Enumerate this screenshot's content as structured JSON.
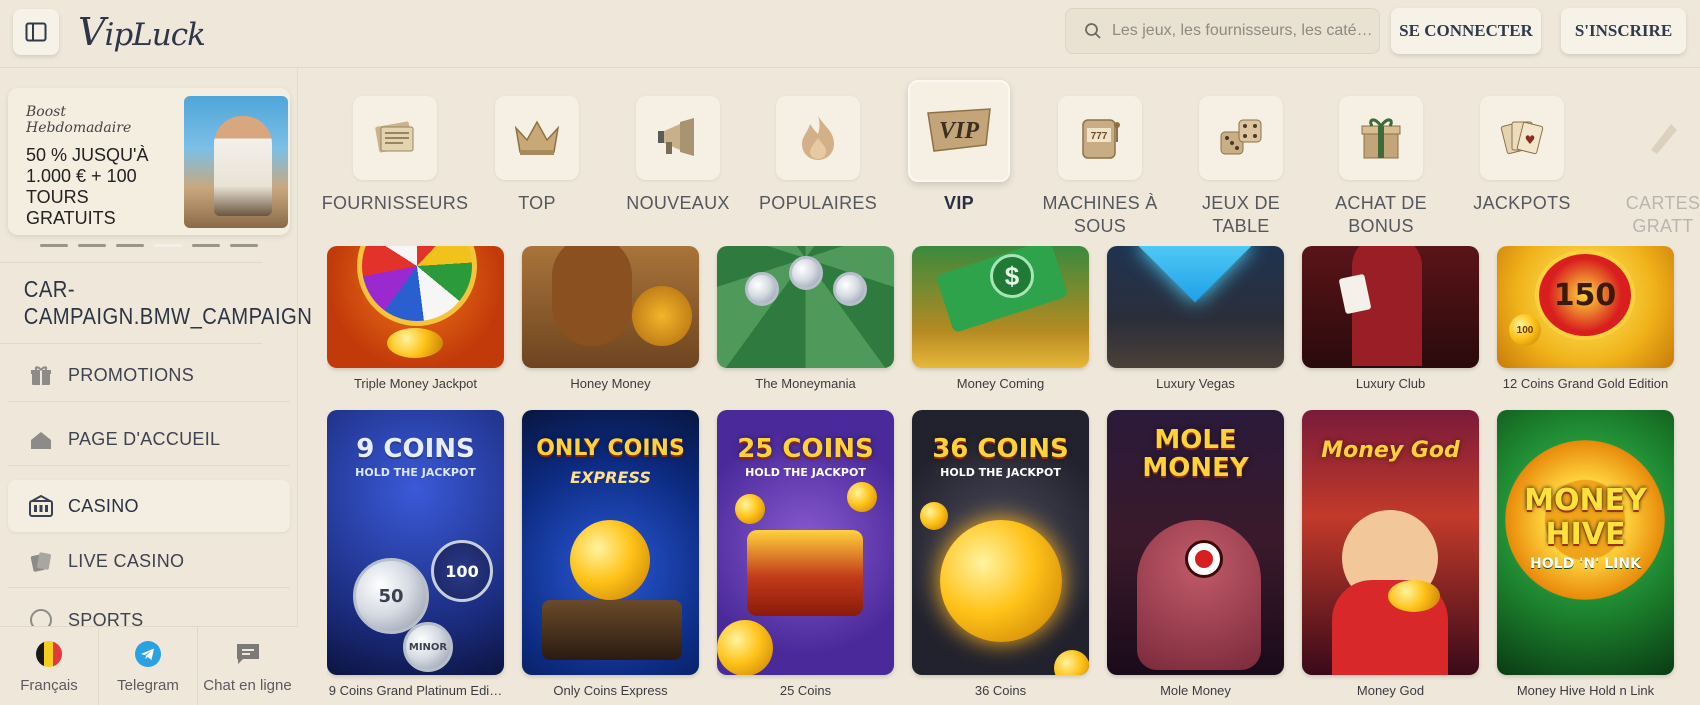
{
  "header": {
    "logo": {
      "initial": "V",
      "rest1": "ip",
      "rest2": "Luck"
    },
    "search_placeholder": "Les jeux, les fournisseurs, les caté…",
    "login_label": "SE CONNECTER",
    "signup_label": "S'INSCRIRE"
  },
  "sidebar": {
    "promo": {
      "tag_line1": "Boost",
      "tag_line2": "Hebdomadaire",
      "title": "50 % JUSQU'À 1.000 € + 100 TOURS GRATUITS"
    },
    "campaign": "CAR-CAMPAIGN.BMW_CAMPAIGN",
    "nav": [
      {
        "label": "PROMOTIONS",
        "icon": "gift-icon"
      },
      {
        "label": "PAGE D'ACCUEIL",
        "icon": "home-icon"
      },
      {
        "label": "CASINO",
        "icon": "casino-icon",
        "active": true
      },
      {
        "label": "LIVE CASINO",
        "icon": "cards-icon"
      },
      {
        "label": "SPORTS",
        "icon": "sports-icon"
      }
    ],
    "bottom": [
      {
        "label": "Français",
        "icon": "belgium-flag-icon"
      },
      {
        "label": "Telegram",
        "icon": "telegram-icon"
      },
      {
        "label": "Chat en ligne",
        "icon": "chat-icon"
      }
    ]
  },
  "categories": [
    {
      "label": "FOURNISSEURS",
      "icon": "newspaper-icon"
    },
    {
      "label": "TOP",
      "icon": "crown-icon"
    },
    {
      "label": "NOUVEAUX",
      "icon": "megaphone-icon"
    },
    {
      "label": "POPULAIRES",
      "icon": "flame-icon"
    },
    {
      "label": "VIP",
      "icon": "vip-icon",
      "active": true
    },
    {
      "label": "MACHINES À SOUS",
      "icon": "slot-machine-icon"
    },
    {
      "label": "JEUX DE TABLE",
      "icon": "dice-icon"
    },
    {
      "label": "ACHAT DE BONUS",
      "icon": "gift-box-icon"
    },
    {
      "label": "JACKPOTS",
      "icon": "playing-cards-icon"
    },
    {
      "label": "CARTES GRATT",
      "icon": "scratch-card-icon"
    }
  ],
  "games_row1": [
    "Triple Money Jackpot",
    "Honey Money",
    "The Moneymania",
    "Money Coming",
    "Luxury Vegas",
    "Luxury Club",
    "12 Coins Grand Gold Edition"
  ],
  "games_row2": [
    "9 Coins Grand Platinum Edi…",
    "Only Coins Express",
    "25 Coins",
    "36 Coins",
    "Mole Money",
    "Money God",
    "Money Hive Hold n Link"
  ],
  "thumb_art": {
    "money_coming_symbol": "$",
    "coins12_value": "150",
    "coins12_small": "100",
    "coins9_title": "9 COINS",
    "coins9_sub": "HOLD THE JACKPOT",
    "coins9_values": [
      "100",
      "50",
      "MINOR"
    ],
    "only_coins_title": "ONLY COINS",
    "only_coins_sub": "EXPRESS",
    "coins25_title": "25 COINS",
    "coins25_sub": "HOLD THE JACKPOT",
    "coins36_title": "36 COINS",
    "coins36_sub": "HOLD THE JACKPOT",
    "mole_title1": "MOLE",
    "mole_title2": "MONEY",
    "money_god_title": "Money God",
    "hive_title1": "MONEY",
    "hive_title2": "HIVE",
    "hive_sub": "HOLD 'N' LINK"
  },
  "colors": {
    "background": "#efe8da",
    "tile": "#f6f0e4",
    "text_dark": "#2f3a4a"
  }
}
